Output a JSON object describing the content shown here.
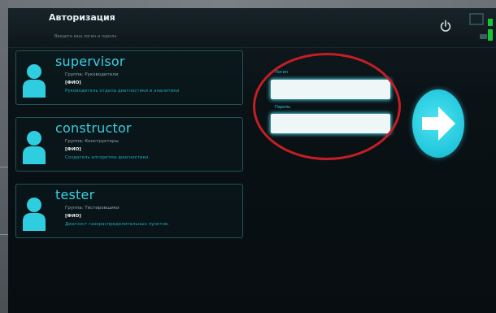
{
  "header": {
    "title": "Авторизация",
    "subtitle": "Введите ваш логин и пароль"
  },
  "users": [
    {
      "name": "supervisor",
      "group": "Группа: Руководители",
      "fio": "[ФИО]",
      "description": "Руководитель отдела диагностики и аналитики"
    },
    {
      "name": "constructor",
      "group": "Группа: Конструкторы",
      "fio": "[ФИО]",
      "description": "Создатель алгоритма диагностики."
    },
    {
      "name": "tester",
      "group": "Группа: Тестировщики",
      "fio": "[ФИО]",
      "description": "Диагност газораспределительных пунктов."
    }
  ],
  "form": {
    "login_label": "Логин",
    "login_value": "",
    "password_label": "Пароль",
    "password_value": ""
  },
  "icons": {
    "power": "power-icon",
    "network": "network-status-icon",
    "submit": "arrow-right-icon",
    "avatar": "user-avatar-icon"
  },
  "colors": {
    "accent": "#39d0e0",
    "button": "#22c7dc",
    "highlight": "#c41e24",
    "network_ok": "#22c43a"
  }
}
